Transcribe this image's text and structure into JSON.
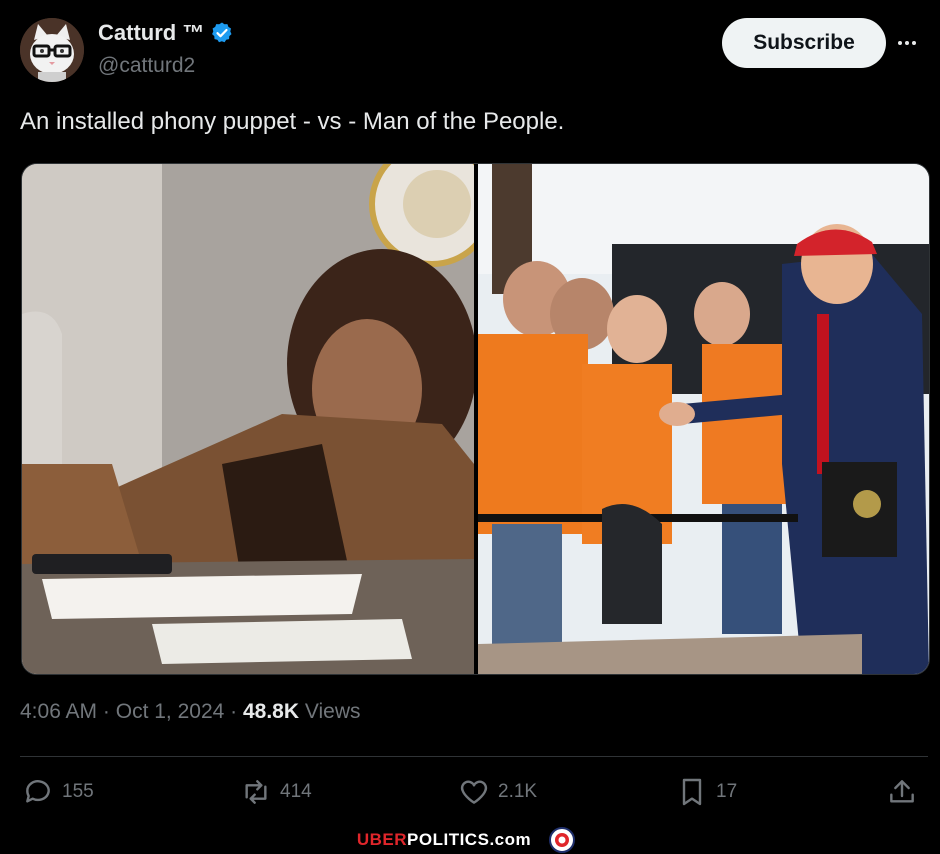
{
  "author": {
    "display_name": "Catturd ™",
    "handle": "@catturd2",
    "verified": true,
    "avatar_icon": "cat-with-glasses-avatar"
  },
  "header": {
    "subscribe_label": "Subscribe",
    "more_icon": "more-horizontal-icon"
  },
  "tweet": {
    "text": "An installed phony puppet - vs  - Man of the People."
  },
  "meta": {
    "time": "4:06 AM",
    "sep1": " · ",
    "date": "Oct 1, 2024",
    "sep2": " · ",
    "views_count": "48.8K",
    "views_label": " Views"
  },
  "actions": {
    "replies": "155",
    "reposts": "414",
    "likes": "2.1K",
    "bookmarks": "17"
  },
  "watermark": {
    "part1": "UBER",
    "part2": "POLITICS",
    "part3": ".com"
  },
  "colors": {
    "background": "#000000",
    "verified_blue": "#1d9bf0",
    "secondary_text": "#71767b",
    "watermark_red": "#e0262b"
  }
}
